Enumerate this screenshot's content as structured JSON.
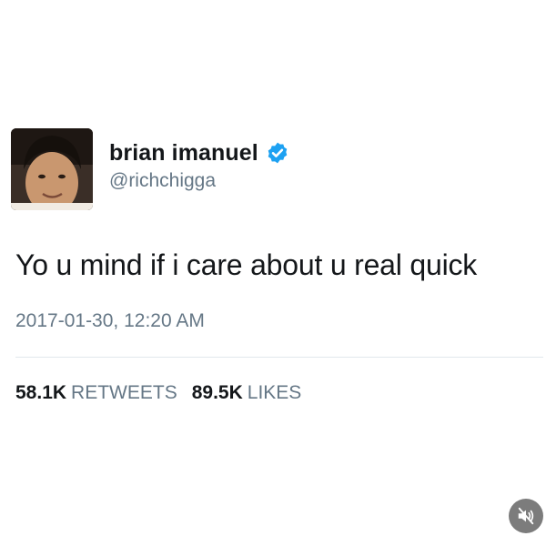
{
  "tweet": {
    "author": {
      "display_name": "brian imanuel",
      "handle": "@richchigga",
      "verified": true,
      "avatar_icon": "user-avatar-photo"
    },
    "text": "Yo u mind if i care about u real quick",
    "timestamp": "2017-01-30, 12:20 AM",
    "stats": {
      "retweets_count": "58.1K",
      "retweets_label": "RETWEETS",
      "likes_count": "89.5K",
      "likes_label": "LIKES"
    }
  },
  "overlay": {
    "mute_icon": "speaker-muted-icon"
  },
  "colors": {
    "text_primary": "#14171a",
    "text_secondary": "#657786",
    "verified_blue": "#1da1f2",
    "divider": "#e1e8ed",
    "background": "#ffffff"
  }
}
